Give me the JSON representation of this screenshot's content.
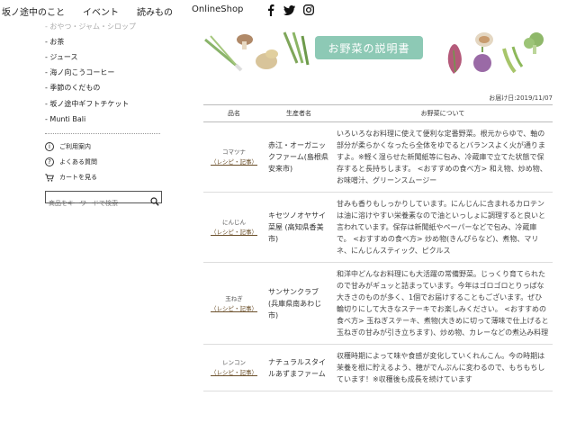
{
  "nav": {
    "items": [
      "坂ノ途中のこと",
      "イベント",
      "読みもの",
      "OnlineShop"
    ],
    "social_icons": [
      "facebook-icon",
      "twitter-icon",
      "instagram-icon"
    ]
  },
  "sidebar": {
    "faded_item": "- おやつ・ジャム・シロップ",
    "items": [
      "- お茶",
      "- ジュース",
      "- 海ノ向こうコーヒー",
      "- 季節のくだもの",
      "- 坂ノ途中ギフトチケット",
      "- Munti Bali"
    ],
    "utility_links": [
      {
        "label": "ご利用案内",
        "icon": "info-icon"
      },
      {
        "label": "よくある質問",
        "icon": "question-icon"
      },
      {
        "label": "カートを見る",
        "icon": "cart-icon"
      }
    ],
    "search_placeholder": "商品をキーワードで検索"
  },
  "banner": {
    "title": "お野菜の説明書"
  },
  "delivery_date": "お届け日:2019/11/07",
  "table": {
    "headers": [
      "品名",
      "生産者名",
      "お野菜について"
    ],
    "rows": [
      {
        "name": "コマツナ",
        "link": "（レシピ・記事）",
        "producer": "赤江・オーガニックファーム(島根県安来市)",
        "desc": "いろいろなお料理に使えて便利な定番野菜。根元からゆで、軸の部分が柔らかくなったら全体をゆでるとバランスよく火が通りますよ。※軽く湿らせた新聞紙等に包み、冷蔵庫で立てた状態で保存すると長持ちします。 <おすすめの食べ方> 和え物、炒め物、お味噌汁、グリーンスムージー"
      },
      {
        "name": "にんじん",
        "link": "（レシピ・記事）",
        "producer": "キセツノオヤサイ菜屋 (高知県香美市)",
        "desc": "甘みも香りもしっかりしています。にんじんに含まれるカロテンは油に溶けやすい栄養素なので油といっしょに調理すると良いと言われています。保存は新聞紙やペーパーなどで包み、冷蔵庫で。 <おすすめの食べ方> 炒め物(きんぴらなど)、煮物、マリネ、にんじんスティック、ピクルス"
      },
      {
        "name": "玉ねぎ",
        "link": "（レシピ・記事）",
        "producer": "サンサンクラブ (兵庫県南あわじ市)",
        "desc": "和洋中どんなお料理にも大活躍の常備野菜。じっくり育てられたので甘みがギュッと詰まっています。今年はゴロゴロとりっぱな大きさのものが多く、1個でお届けすることもございます。ぜひ輪切りにして大きなステーキでお楽しみください。 <おすすめの食べ方> 玉ねぎステーキ、煮物(大きめに切って薄味で仕上げると玉ねぎの甘みが引き立ちます)、炒め物、カレーなどの煮込み料理"
      },
      {
        "name": "レンコン",
        "link": "（レシピ・記事）",
        "producer": "ナチュラルスタイルあずまファーム",
        "desc": "収穫時期によって味や食感が変化していくれんこん。今の時期は茉養を根に貯えるよう、穂がでんぷんに変わるので、もちもちしています！※収穫後も成長を続けています"
      }
    ]
  }
}
